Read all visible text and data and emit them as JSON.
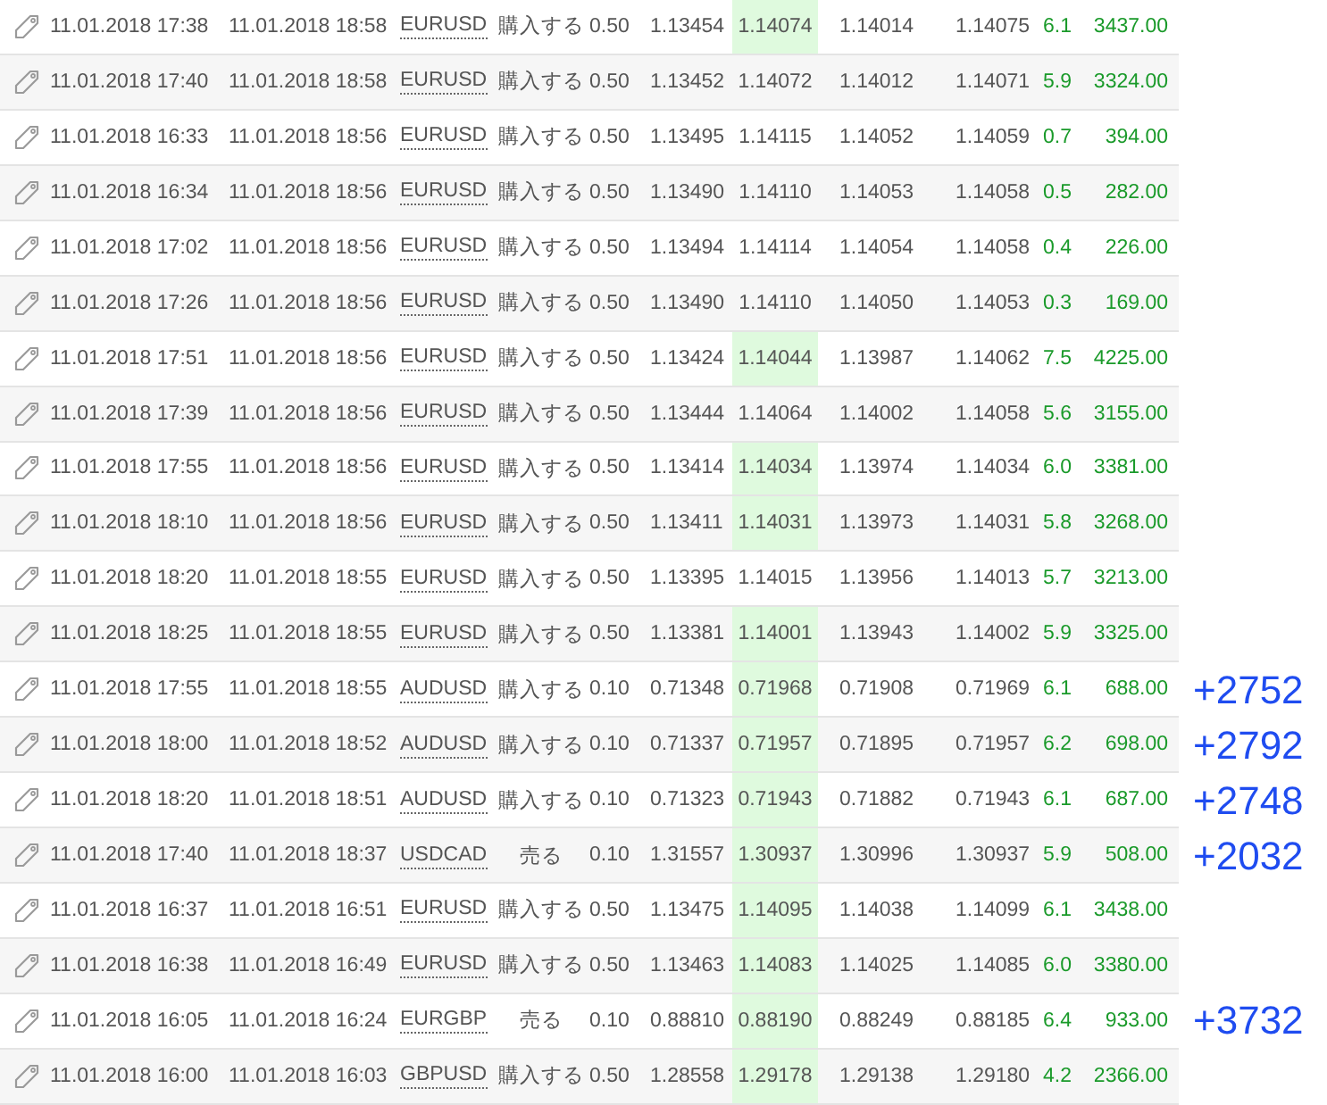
{
  "rows": [
    {
      "open_time": "11.01.2018 17:38",
      "close_time": "11.01.2018 18:58",
      "symbol": "EURUSD",
      "type": "購入する",
      "lots": "0.50",
      "open_price": "1.13454",
      "close_price": "1.14074",
      "highlighted": true,
      "column_9": "1.14014",
      "column_10": "1.14075",
      "pips": "6.1",
      "profit": "3437.00"
    },
    {
      "open_time": "11.01.2018 17:40",
      "close_time": "11.01.2018 18:58",
      "symbol": "EURUSD",
      "type": "購入する",
      "lots": "0.50",
      "open_price": "1.13452",
      "close_price": "1.14072",
      "highlighted": false,
      "column_9": "1.14012",
      "column_10": "1.14071",
      "pips": "5.9",
      "profit": "3324.00"
    },
    {
      "open_time": "11.01.2018 16:33",
      "close_time": "11.01.2018 18:56",
      "symbol": "EURUSD",
      "type": "購入する",
      "lots": "0.50",
      "open_price": "1.13495",
      "close_price": "1.14115",
      "highlighted": false,
      "column_9": "1.14052",
      "column_10": "1.14059",
      "pips": "0.7",
      "profit": "394.00"
    },
    {
      "open_time": "11.01.2018 16:34",
      "close_time": "11.01.2018 18:56",
      "symbol": "EURUSD",
      "type": "購入する",
      "lots": "0.50",
      "open_price": "1.13490",
      "close_price": "1.14110",
      "highlighted": false,
      "column_9": "1.14053",
      "column_10": "1.14058",
      "pips": "0.5",
      "profit": "282.00"
    },
    {
      "open_time": "11.01.2018 17:02",
      "close_time": "11.01.2018 18:56",
      "symbol": "EURUSD",
      "type": "購入する",
      "lots": "0.50",
      "open_price": "1.13494",
      "close_price": "1.14114",
      "highlighted": false,
      "column_9": "1.14054",
      "column_10": "1.14058",
      "pips": "0.4",
      "profit": "226.00"
    },
    {
      "open_time": "11.01.2018 17:26",
      "close_time": "11.01.2018 18:56",
      "symbol": "EURUSD",
      "type": "購入する",
      "lots": "0.50",
      "open_price": "1.13490",
      "close_price": "1.14110",
      "highlighted": false,
      "column_9": "1.14050",
      "column_10": "1.14053",
      "pips": "0.3",
      "profit": "169.00"
    },
    {
      "open_time": "11.01.2018 17:51",
      "close_time": "11.01.2018 18:56",
      "symbol": "EURUSD",
      "type": "購入する",
      "lots": "0.50",
      "open_price": "1.13424",
      "close_price": "1.14044",
      "highlighted": true,
      "column_9": "1.13987",
      "column_10": "1.14062",
      "pips": "7.5",
      "profit": "4225.00"
    },
    {
      "open_time": "11.01.2018 17:39",
      "close_time": "11.01.2018 18:56",
      "symbol": "EURUSD",
      "type": "購入する",
      "lots": "0.50",
      "open_price": "1.13444",
      "close_price": "1.14064",
      "highlighted": false,
      "column_9": "1.14002",
      "column_10": "1.14058",
      "pips": "5.6",
      "profit": "3155.00"
    },
    {
      "open_time": "11.01.2018 17:55",
      "close_time": "11.01.2018 18:56",
      "symbol": "EURUSD",
      "type": "購入する",
      "lots": "0.50",
      "open_price": "1.13414",
      "close_price": "1.14034",
      "highlighted": true,
      "column_9": "1.13974",
      "column_10": "1.14034",
      "pips": "6.0",
      "profit": "3381.00"
    },
    {
      "open_time": "11.01.2018 18:10",
      "close_time": "11.01.2018 18:56",
      "symbol": "EURUSD",
      "type": "購入する",
      "lots": "0.50",
      "open_price": "1.13411",
      "close_price": "1.14031",
      "highlighted": true,
      "column_9": "1.13973",
      "column_10": "1.14031",
      "pips": "5.8",
      "profit": "3268.00"
    },
    {
      "open_time": "11.01.2018 18:20",
      "close_time": "11.01.2018 18:55",
      "symbol": "EURUSD",
      "type": "購入する",
      "lots": "0.50",
      "open_price": "1.13395",
      "close_price": "1.14015",
      "highlighted": false,
      "column_9": "1.13956",
      "column_10": "1.14013",
      "pips": "5.7",
      "profit": "3213.00"
    },
    {
      "open_time": "11.01.2018 18:25",
      "close_time": "11.01.2018 18:55",
      "symbol": "EURUSD",
      "type": "購入する",
      "lots": "0.50",
      "open_price": "1.13381",
      "close_price": "1.14001",
      "highlighted": true,
      "column_9": "1.13943",
      "column_10": "1.14002",
      "pips": "5.9",
      "profit": "3325.00"
    },
    {
      "open_time": "11.01.2018 17:55",
      "close_time": "11.01.2018 18:55",
      "symbol": "AUDUSD",
      "type": "購入する",
      "lots": "0.10",
      "open_price": "0.71348",
      "close_price": "0.71968",
      "highlighted": true,
      "column_9": "0.71908",
      "column_10": "0.71969",
      "pips": "6.1",
      "profit": "688.00",
      "note": "+2752"
    },
    {
      "open_time": "11.01.2018 18:00",
      "close_time": "11.01.2018 18:52",
      "symbol": "AUDUSD",
      "type": "購入する",
      "lots": "0.10",
      "open_price": "0.71337",
      "close_price": "0.71957",
      "highlighted": true,
      "column_9": "0.71895",
      "column_10": "0.71957",
      "pips": "6.2",
      "profit": "698.00",
      "note": "+2792"
    },
    {
      "open_time": "11.01.2018 18:20",
      "close_time": "11.01.2018 18:51",
      "symbol": "AUDUSD",
      "type": "購入する",
      "lots": "0.10",
      "open_price": "0.71323",
      "close_price": "0.71943",
      "highlighted": true,
      "column_9": "0.71882",
      "column_10": "0.71943",
      "pips": "6.1",
      "profit": "687.00",
      "note": "+2748"
    },
    {
      "open_time": "11.01.2018 17:40",
      "close_time": "11.01.2018 18:37",
      "symbol": "USDCAD",
      "type": "売る",
      "lots": "0.10",
      "open_price": "1.31557",
      "close_price": "1.30937",
      "highlighted": true,
      "column_9": "1.30996",
      "column_10": "1.30937",
      "pips": "5.9",
      "profit": "508.00",
      "note": "+2032"
    },
    {
      "open_time": "11.01.2018 16:37",
      "close_time": "11.01.2018 16:51",
      "symbol": "EURUSD",
      "type": "購入する",
      "lots": "0.50",
      "open_price": "1.13475",
      "close_price": "1.14095",
      "highlighted": true,
      "column_9": "1.14038",
      "column_10": "1.14099",
      "pips": "6.1",
      "profit": "3438.00"
    },
    {
      "open_time": "11.01.2018 16:38",
      "close_time": "11.01.2018 16:49",
      "symbol": "EURUSD",
      "type": "購入する",
      "lots": "0.50",
      "open_price": "1.13463",
      "close_price": "1.14083",
      "highlighted": true,
      "column_9": "1.14025",
      "column_10": "1.14085",
      "pips": "6.0",
      "profit": "3380.00"
    },
    {
      "open_time": "11.01.2018 16:05",
      "close_time": "11.01.2018 16:24",
      "symbol": "EURGBP",
      "type": "売る",
      "lots": "0.10",
      "open_price": "0.88810",
      "close_price": "0.88190",
      "highlighted": true,
      "column_9": "0.88249",
      "column_10": "0.88185",
      "pips": "6.4",
      "profit": "933.00",
      "note": "+3732"
    },
    {
      "open_time": "11.01.2018 16:00",
      "close_time": "11.01.2018 16:03",
      "symbol": "GBPUSD",
      "type": "購入する",
      "lots": "0.50",
      "open_price": "1.28558",
      "close_price": "1.29178",
      "highlighted": true,
      "column_9": "1.29138",
      "column_10": "1.29180",
      "pips": "4.2",
      "profit": "2366.00"
    }
  ]
}
